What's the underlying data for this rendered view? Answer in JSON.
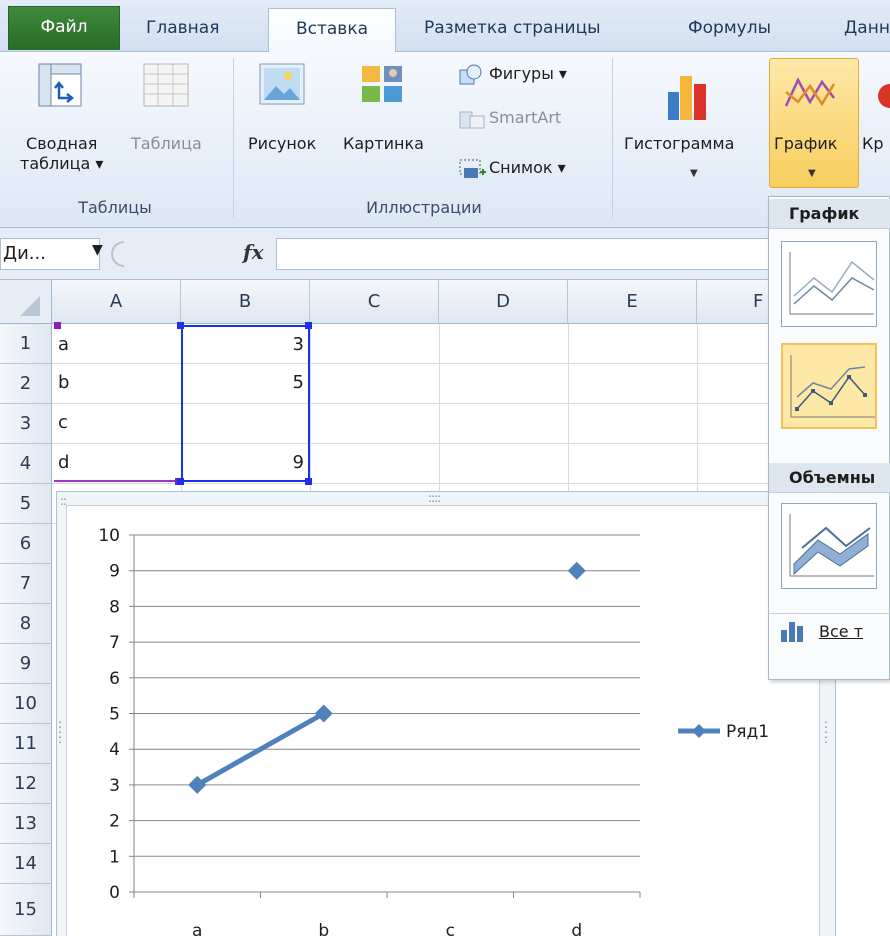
{
  "tabs": [
    "Файл",
    "Главная",
    "Вставка",
    "Разметка страницы",
    "Формулы",
    "Данн"
  ],
  "ribbon": {
    "pivot_label": [
      "Сводная",
      "таблица ▾"
    ],
    "table_label": "Таблица",
    "group_tables": "Таблицы",
    "picture_label": "Рисунок",
    "clipart_label": "Картинка",
    "shapes_label": "Фигуры ▾",
    "smartart_label": "SmartArt",
    "screenshot_label": "Снимок ▾",
    "group_illustrations": "Иллюстрации",
    "histogram_label": "Гистограмма",
    "line_chart_label": "График",
    "next_label": "Кр"
  },
  "formula_bar": {
    "namebox": "Ди...",
    "fx": "fx",
    "formula": ""
  },
  "columns": [
    "A",
    "B",
    "C",
    "D",
    "E",
    "F"
  ],
  "rows": [
    "1",
    "2",
    "3",
    "4",
    "5",
    "6",
    "7",
    "8",
    "9",
    "10",
    "11",
    "12",
    "13",
    "14",
    "15"
  ],
  "cells": {
    "a1": "a",
    "b1": "3",
    "a2": "b",
    "b2": "5",
    "a3": "c",
    "b3": "",
    "a4": "d",
    "b4": "9"
  },
  "gallery": {
    "header_line": "График",
    "header_3d": "Объемны",
    "all_types": "Все т"
  },
  "chart_data": {
    "type": "line",
    "categories": [
      "a",
      "b",
      "c",
      "d"
    ],
    "series": [
      {
        "name": "Ряд1",
        "values": [
          3,
          5,
          null,
          9
        ],
        "color": "#4f81bd"
      }
    ],
    "ylim": [
      0,
      10
    ],
    "yticks": [
      0,
      1,
      2,
      3,
      4,
      5,
      6,
      7,
      8,
      9,
      10
    ],
    "legend": "right",
    "grid": true
  }
}
